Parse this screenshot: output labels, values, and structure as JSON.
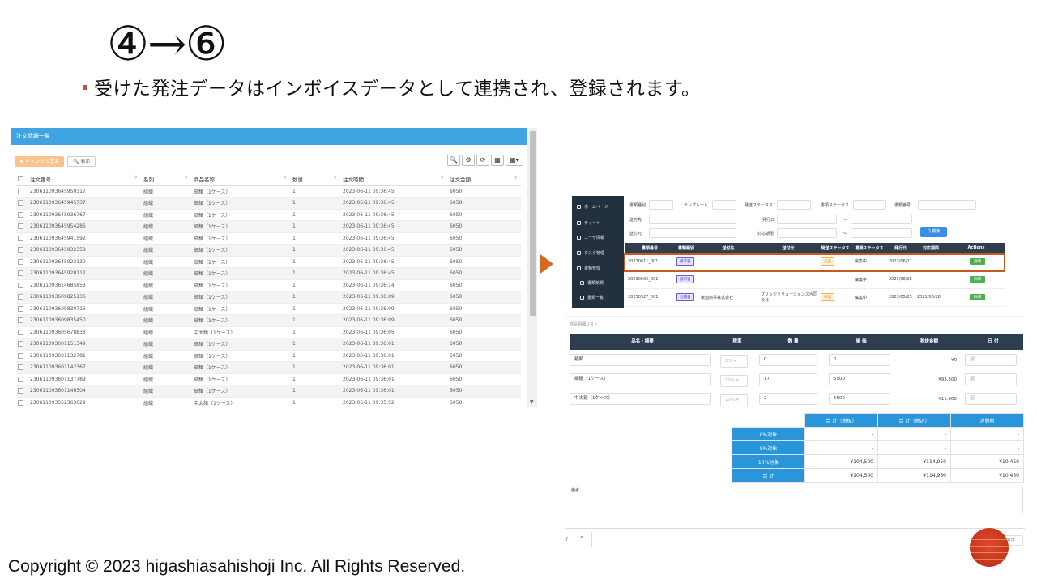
{
  "slide": {
    "title": "④→⑥",
    "bullet": "受けた発注データはインボイスデータとして連携され、登録されます。",
    "copyright": "Copyright © 2023 higashiasahishoji Inc. All Rights Reserved."
  },
  "left": {
    "header": "注文情報一覧",
    "cancel_label": "✖ キャンセル注文",
    "show_label": "🔍 表示",
    "tools": [
      "🔍",
      "⚙",
      "⟳",
      "▦",
      "▦▾"
    ],
    "columns": [
      "注文番号",
      "系列",
      "商品名称",
      "数量",
      "注文時間",
      "注文金額"
    ],
    "rows": [
      [
        "230611093645950317",
        "組織",
        "細麺（1ケース）",
        "1",
        "2023-06-11 09:36:45",
        "6050"
      ],
      [
        "230611093645945737",
        "組織",
        "細麺（1ケース）",
        "1",
        "2023-06-11 09:36:45",
        "6050"
      ],
      [
        "230611093645936767",
        "組織",
        "細麺（1ケース）",
        "1",
        "2023-06-11 09:36:45",
        "6050"
      ],
      [
        "230611093645954286",
        "組織",
        "細麺（1ケース）",
        "1",
        "2023-06-11 09:36:45",
        "6050"
      ],
      [
        "230611093645941592",
        "組織",
        "細麺（1ケース）",
        "1",
        "2023-06-11 09:36:45",
        "6050"
      ],
      [
        "230611093645932358",
        "組織",
        "細麺（1ケース）",
        "1",
        "2023-06-11 09:36:45",
        "6050"
      ],
      [
        "230611093645923130",
        "組織",
        "細麺（1ケース）",
        "1",
        "2023-06-11 09:36:45",
        "6050"
      ],
      [
        "230611093645928112",
        "組織",
        "細麺（1ケース）",
        "1",
        "2023-06-11 09:36:45",
        "6050"
      ],
      [
        "230611093614685853",
        "組織",
        "細麺（1ケース）",
        "1",
        "2023-06-11 09:36:14",
        "6050"
      ],
      [
        "230611093609825136",
        "組織",
        "細麺（1ケース）",
        "1",
        "2023-06-11 09:36:09",
        "6050"
      ],
      [
        "230611093609830715",
        "組織",
        "細麺（1ケース）",
        "1",
        "2023-06-11 09:36:09",
        "6050"
      ],
      [
        "230611093609835450",
        "組織",
        "細麺（1ケース）",
        "1",
        "2023-06-11 09:36:09",
        "6050"
      ],
      [
        "230611093605678833",
        "組織",
        "中太麺（1ケース）",
        "1",
        "2023-06-11 09:36:05",
        "6050"
      ],
      [
        "230611093601151349",
        "組織",
        "細麺（1ケース）",
        "1",
        "2023-06-11 09:36:01",
        "6050"
      ],
      [
        "230611093601132781",
        "組織",
        "細麺（1ケース）",
        "1",
        "2023-06-11 09:36:01",
        "6050"
      ],
      [
        "230611093601142367",
        "組織",
        "細麺（1ケース）",
        "1",
        "2023-06-11 09:36:01",
        "6050"
      ],
      [
        "230611093601137789",
        "組織",
        "細麺（1ケース）",
        "1",
        "2023-06-11 09:36:01",
        "6050"
      ],
      [
        "230611093601146504",
        "組織",
        "細麺（1ケース）",
        "1",
        "2023-06-11 09:36:01",
        "6050"
      ],
      [
        "230611093552363029",
        "組織",
        "中太麺（1ケース）",
        "1",
        "2023-06-11 09:35:52",
        "6050"
      ]
    ]
  },
  "right": {
    "sidebar": [
      "ホームページ",
      "チャート",
      "ユーザ情報",
      "タスク管理",
      "書類管理",
      "書類新規",
      "書類一覧"
    ],
    "filters": {
      "doc_type": "書類種別",
      "template": "テンプレート",
      "send_status": "発送ステータス",
      "doc_status": "書類ステータス",
      "doc_no": "書類番号",
      "to": "送付先",
      "issue_date": "発行日",
      "from": "送付元",
      "period": "対応期限",
      "search": "Q 検索"
    },
    "doc_columns": [
      "書類番号",
      "書類種別",
      "送付先",
      "送付元",
      "発送ステータス",
      "書類ステータス",
      "発行日",
      "対応期限",
      "Actions"
    ],
    "doc_rows": [
      {
        "no": "20230611_001",
        "type": "請求書",
        "to": "",
        "from": "",
        "send": "未送",
        "status": "編集中",
        "issue": "2023/06/11",
        "due": "",
        "action": "詳細"
      },
      {
        "no": "20230606_001",
        "type": "請求書",
        "to": "",
        "from": "",
        "send": "",
        "status": "編集中",
        "issue": "2023/06/06",
        "due": "",
        "action": "詳細"
      },
      {
        "no": "20230527_001",
        "type": "見積書",
        "to": "東旭商事株式会社",
        "from": "ブリッジソリューションズ合同会社",
        "send": "未送",
        "status": "編集中",
        "issue": "2023/05/25",
        "due": "2021/06/28",
        "action": "詳細"
      }
    ],
    "item_section": "商品明細リスト",
    "item_columns": [
      "品名・摘要",
      "税率",
      "数 量",
      "単 価",
      "税抜金額",
      "日 付"
    ],
    "items": [
      {
        "name": "麺類",
        "rate": "0%",
        "qty": "0",
        "price": "0",
        "amount": "¥0"
      },
      {
        "name": "細麺（1ケース）",
        "rate": "10%",
        "qty": "17",
        "price": "5500",
        "amount": "¥93,500"
      },
      {
        "name": "中太麺（1ケース）",
        "rate": "10%",
        "qty": "2",
        "price": "5500",
        "amount": "¥11,000"
      }
    ],
    "total_headers": [
      "合 計（税抜）",
      "合 計（税込）",
      "消費税"
    ],
    "totals": [
      {
        "label": "0%対象",
        "a": "-",
        "b": "-",
        "c": "-"
      },
      {
        "label": "8%対象",
        "a": "-",
        "b": "-",
        "c": "-"
      },
      {
        "label": "10%対象",
        "a": "¥104,500",
        "b": "¥114,950",
        "c": "¥10,450"
      },
      {
        "label": "合 計",
        "a": "¥104,500",
        "b": "¥114,950",
        "c": "¥10,450"
      }
    ],
    "note_label": "備考",
    "bottom_left": "ıf",
    "show_all": "すべて表示"
  }
}
